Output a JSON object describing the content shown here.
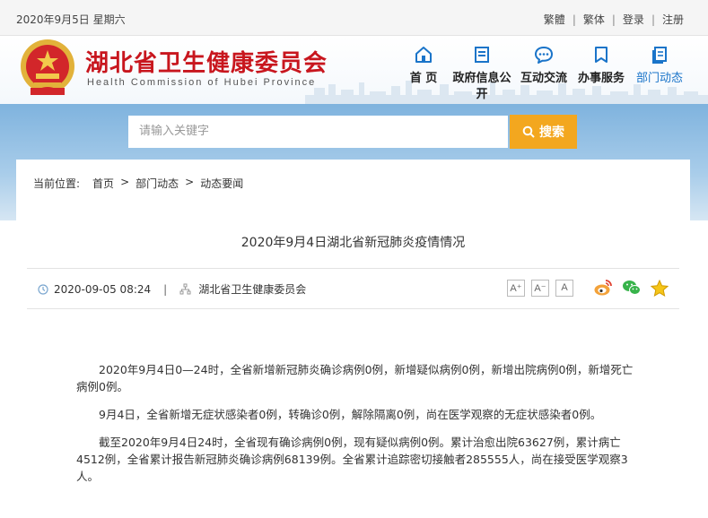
{
  "topbar": {
    "date": "2020年9月5日 星期六",
    "links": [
      "繁體",
      "繁体",
      "登录",
      "注册"
    ]
  },
  "header": {
    "title": "湖北省卫生健康委员会",
    "subtitle": "Health Commission of Hubei Province",
    "nav": [
      {
        "label": "首 页",
        "icon": "home-icon"
      },
      {
        "label": "政府信息公开",
        "icon": "document-icon"
      },
      {
        "label": "互动交流",
        "icon": "chat-icon"
      },
      {
        "label": "办事服务",
        "icon": "bookmark-icon"
      },
      {
        "label": "部门动态",
        "icon": "pages-icon"
      }
    ],
    "active_nav": "部门动态"
  },
  "search": {
    "placeholder": "请输入关键字",
    "button_label": "搜索"
  },
  "breadcrumb": {
    "prefix": "当前位置:",
    "items": [
      "首页",
      "部门动态",
      "动态要闻"
    ],
    "separator": ">"
  },
  "article": {
    "title": "2020年9月4日湖北省新冠肺炎疫情情况",
    "datetime": "2020-09-05 08:24",
    "source": "湖北省卫生健康委员会",
    "font_buttons": [
      "A⁺",
      "A⁻",
      "A"
    ],
    "paragraphs": [
      "2020年9月4日0—24时，全省新增新冠肺炎确诊病例0例，新增疑似病例0例，新增出院病例0例，新增死亡病例0例。",
      "9月4日，全省新增无症状感染者0例，转确诊0例，解除隔离0例，尚在医学观察的无症状感染者0例。",
      "截至2020年9月4日24时，全省现有确诊病例0例，现有疑似病例0例。累计治愈出院63627例，累计病亡4512例，全省累计报告新冠肺炎确诊病例68139例。全省累计追踪密切接触者285555人，尚在接受医学观察3人。"
    ]
  },
  "colors": {
    "title_red": "#c8161e",
    "nav_active": "#1a74c9",
    "search_button": "#f3a71f",
    "band_blue": "#7fb3de"
  }
}
